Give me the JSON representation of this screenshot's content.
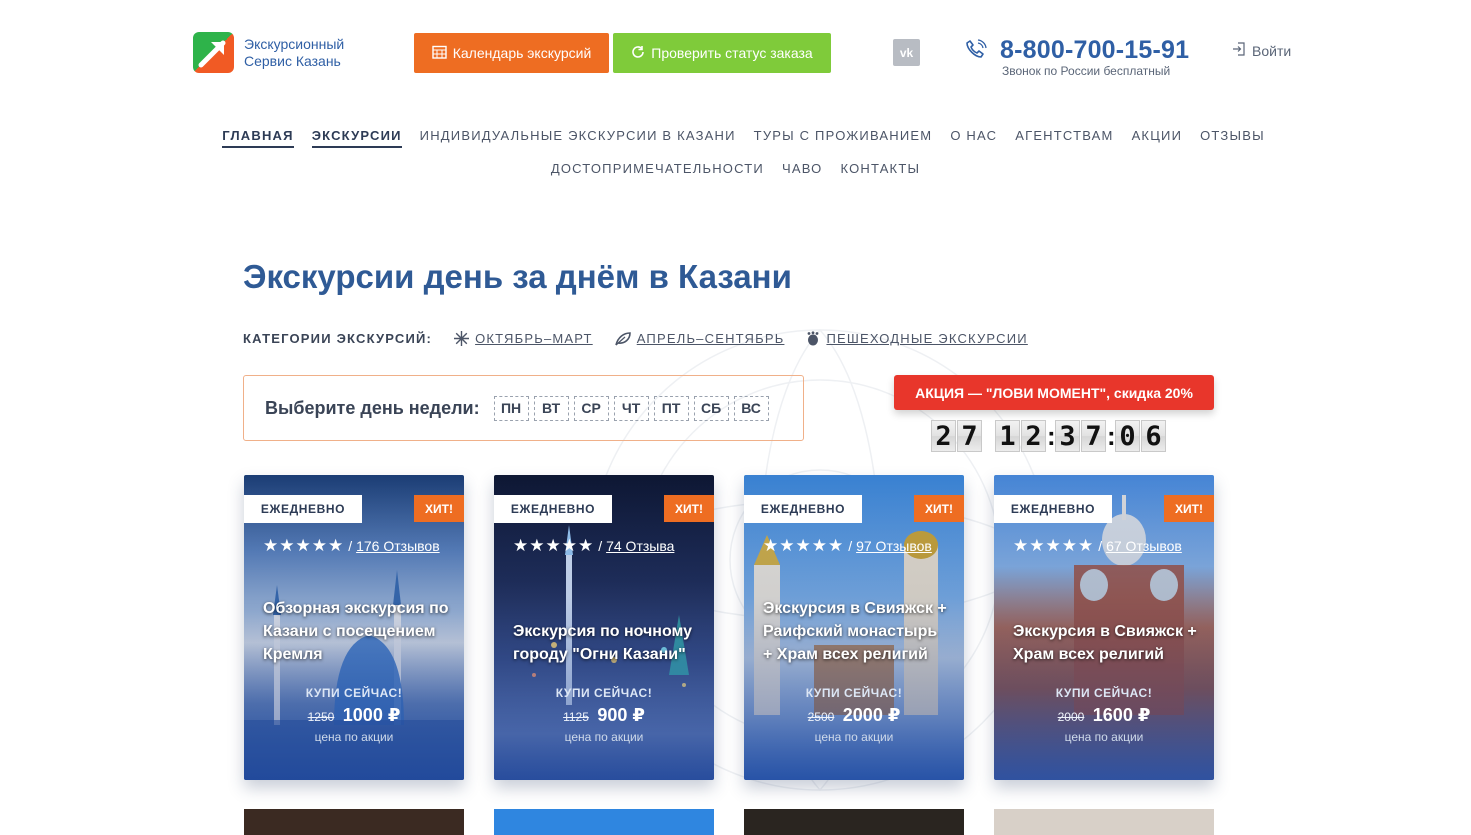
{
  "header": {
    "logo_line1": "Экскурсионный",
    "logo_line2": "Сервис Казань",
    "calendar_button": "Календарь экскурсий",
    "status_button": "Проверить статус заказа",
    "vk_label": "vk",
    "phone": "8-800-700-15-91",
    "phone_note": "Звонок по России бесплатный",
    "login": "Войти"
  },
  "nav": {
    "row1": [
      "ГЛАВНАЯ",
      "ЭКСКУРСИИ",
      "ИНДИВИДУАЛЬНЫЕ ЭКСКУРСИИ В КАЗАНИ",
      "ТУРЫ С ПРОЖИВАНИЕМ",
      "О НАС",
      "АГЕНТСТВАМ",
      "АКЦИИ",
      "ОТЗЫВЫ"
    ],
    "row2": [
      "ДОСТОПРИМЕЧАТЕЛЬНОСТИ",
      "ЧАВО",
      "КОНТАКТЫ"
    ]
  },
  "page_title": "Экскурсии день за днём в Казани",
  "categories": {
    "label": "КАТЕГОРИИ ЭКСКУРСИЙ:",
    "items": [
      "ОКТЯБРЬ–МАРТ",
      "АПРЕЛЬ–СЕНТЯБРЬ",
      "ПЕШЕХОДНЫЕ ЭКСКУРСИИ"
    ]
  },
  "day_select": {
    "label": "Выберите день недели:",
    "days": [
      "ПН",
      "ВТ",
      "СР",
      "ЧТ",
      "ПТ",
      "СБ",
      "ВС"
    ]
  },
  "promo": {
    "label": "АКЦИЯ — \"ЛОВИ МОМЕНТ\", скидка 20%",
    "timer": {
      "days": "27",
      "hours": "12",
      "minutes": "37",
      "seconds": "06"
    }
  },
  "cards": [
    {
      "badge": "ЕЖЕДНЕВНО",
      "hit": "ХИТ!",
      "stars": "★★★★★",
      "reviews": "176 Отзывов",
      "title": "Обзорная экскурсия по Казани с посещением Кремля",
      "buy": "КУПИ СЕЙЧАС!",
      "old_price": "1250",
      "new_price": "1000 ₽",
      "note": "цена по акции"
    },
    {
      "badge": "ЕЖЕДНЕВНО",
      "hit": "ХИТ!",
      "stars": "★★★★★",
      "reviews": "74 Отзыва",
      "title": "Экскурсия по ночному городу \"Огни Казани\"",
      "buy": "КУПИ СЕЙЧАС!",
      "old_price": "1125",
      "new_price": "900 ₽",
      "note": "цена по акции"
    },
    {
      "badge": "ЕЖЕДНЕВНО",
      "hit": "ХИТ!",
      "stars": "★★★★★",
      "reviews": "97 Отзывов",
      "title": "Экскурсия в Свияжск + Раифский монастырь + Храм всех религий",
      "buy": "КУПИ СЕЙЧАС!",
      "old_price": "2500",
      "new_price": "2000 ₽",
      "note": "цена по акции"
    },
    {
      "badge": "ЕЖЕДНЕВНО",
      "hit": "ХИТ!",
      "stars": "★★★★★",
      "reviews": "67 Отзывов",
      "title": "Экскурсия в Свияжск + Храм всех религий",
      "buy": "КУПИ СЕЙЧАС!",
      "old_price": "2000",
      "new_price": "1600 ₽",
      "note": "цена по акции"
    }
  ],
  "colors": {
    "brand_blue": "#2f5fa5",
    "orange": "#ee6d22",
    "green": "#7fcb3a",
    "promo_red": "#e8362b"
  }
}
